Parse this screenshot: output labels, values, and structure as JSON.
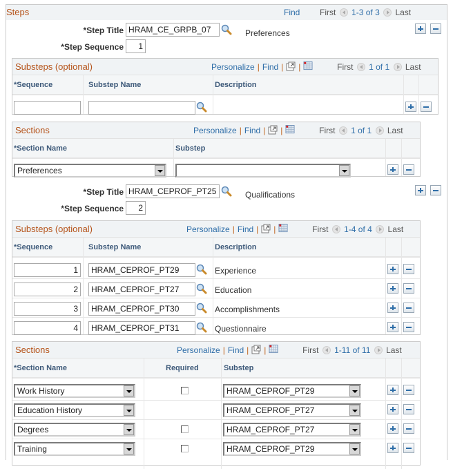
{
  "steps": {
    "title": "Steps",
    "find": "Find",
    "first": "First",
    "range": "1-3 of 3",
    "last": "Last",
    "items": [
      {
        "step_title_label": "*Step Title",
        "step_title_value": "HRAM_CE_GRPB_07",
        "step_description": "Preferences",
        "step_sequence_label": "*Step Sequence",
        "step_sequence_value": "1",
        "substeps": {
          "title": "Substeps (optional)",
          "personalize": "Personalize",
          "find": "Find",
          "first": "First",
          "range": "1 of 1",
          "last": "Last",
          "columns": [
            "*Sequence",
            "Substep Name",
            "Description"
          ],
          "rows": [
            {
              "sequence": "",
              "name": "",
              "description": ""
            }
          ]
        },
        "sections": {
          "title": "Sections",
          "personalize": "Personalize",
          "find": "Find",
          "first": "First",
          "range": "1 of 1",
          "last": "Last",
          "columns": [
            "*Section Name",
            "Substep"
          ],
          "rows": [
            {
              "section_name": "Preferences",
              "substep": ""
            }
          ]
        }
      },
      {
        "step_title_label": "*Step Title",
        "step_title_value": "HRAM_CEPROF_PT25",
        "step_description": "Qualifications",
        "step_sequence_label": "*Step Sequence",
        "step_sequence_value": "2",
        "substeps": {
          "title": "Substeps (optional)",
          "personalize": "Personalize",
          "find": "Find",
          "first": "First",
          "range": "1-4 of 4",
          "last": "Last",
          "columns": [
            "*Sequence",
            "Substep Name",
            "Description"
          ],
          "rows": [
            {
              "sequence": "1",
              "name": "HRAM_CEPROF_PT29",
              "description": "Experience"
            },
            {
              "sequence": "2",
              "name": "HRAM_CEPROF_PT27",
              "description": "Education"
            },
            {
              "sequence": "3",
              "name": "HRAM_CEPROF_PT30",
              "description": "Accomplishments"
            },
            {
              "sequence": "4",
              "name": "HRAM_CEPROF_PT31",
              "description": "Questionnaire"
            }
          ]
        },
        "sections": {
          "title": "Sections",
          "personalize": "Personalize",
          "find": "Find",
          "first": "First",
          "range": "1-11 of 11",
          "last": "Last",
          "columns": [
            "*Section Name",
            "Required",
            "Substep"
          ],
          "rows": [
            {
              "section_name": "Work History",
              "required": false,
              "has_checkbox": true,
              "substep": "HRAM_CEPROF_PT29"
            },
            {
              "section_name": "Education History",
              "required": false,
              "has_checkbox": false,
              "substep": "HRAM_CEPROF_PT27"
            },
            {
              "section_name": "Degrees",
              "required": false,
              "has_checkbox": true,
              "substep": "HRAM_CEPROF_PT27"
            },
            {
              "section_name": "Training",
              "required": false,
              "has_checkbox": true,
              "substep": "HRAM_CEPROF_PT29"
            }
          ]
        }
      }
    ]
  },
  "colors": {
    "section_title": "#b5531a",
    "link": "#2f6ea8",
    "header_bg": "#f0f3f5",
    "column_header_text": "#3e5a7a"
  }
}
